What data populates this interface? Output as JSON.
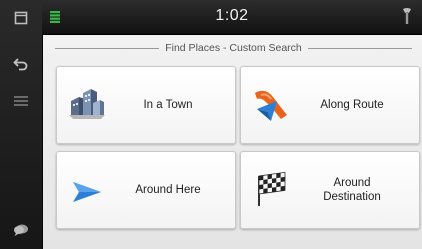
{
  "status": {
    "time": "1:02"
  },
  "sidebar": {
    "items": [
      {
        "name": "menu-icon"
      },
      {
        "name": "back-icon"
      },
      {
        "name": "list-icon"
      },
      {
        "name": "chat-icon"
      }
    ]
  },
  "header": {
    "section_title": "Find Places - Custom Search"
  },
  "options": [
    {
      "label": "In a Town",
      "icon": "town-buildings-icon"
    },
    {
      "label": "Along Route",
      "icon": "route-arrow-icon"
    },
    {
      "label": "Around Here",
      "icon": "position-arrow-icon"
    },
    {
      "label": "Around Destination",
      "icon": "checkered-flag-icon"
    }
  ],
  "colors": {
    "accent_blue": "#2c7fd6",
    "route_orange": "#e8641e",
    "status_green": "#3ab54a"
  }
}
